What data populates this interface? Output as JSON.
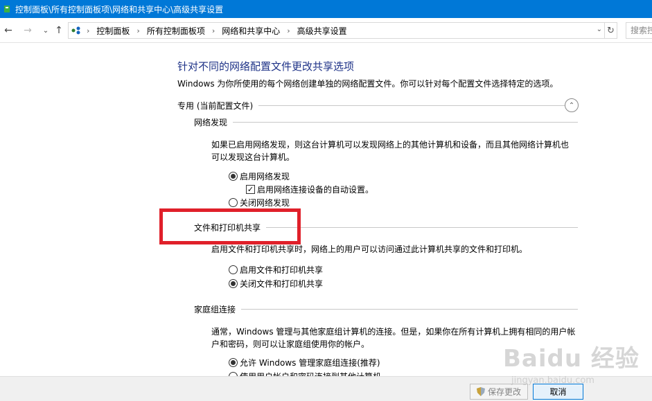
{
  "window": {
    "title": "控制面板\\所有控制面板项\\网络和共享中心\\高级共享设置"
  },
  "nav": {
    "back_icon": "arrow-left-icon",
    "forward_icon": "arrow-right-icon",
    "recent_icon": "chevron-down-icon",
    "up_icon": "arrow-up-icon"
  },
  "address": {
    "crumbs": [
      "控制面板",
      "所有控制面板项",
      "网络和共享中心",
      "高级共享设置"
    ],
    "search_placeholder": "搜索控"
  },
  "page": {
    "title": "针对不同的网络配置文件更改共享选项",
    "description": "Windows 为你所使用的每个网络创建单独的网络配置文件。你可以针对每个配置文件选择特定的选项。"
  },
  "profile": {
    "label": "专用 (当前配置文件)"
  },
  "network_discovery": {
    "heading": "网络发现",
    "text_line1": "如果已启用网络发现，则这台计算机可以发现网络上的其他计算机和设备，而且其他网络计算机也",
    "text_line2": "可以发现这台计算机。",
    "option_on": "启用网络发现",
    "option_auto": "启用网络连接设备的自动设置。",
    "option_off": "关闭网络发现",
    "selected": "on",
    "auto_checked": true
  },
  "file_printer_sharing": {
    "heading": "文件和打印机共享",
    "text": "启用文件和打印机共享时，网络上的用户可以访问通过此计算机共享的文件和打印机。",
    "option_on": "启用文件和打印机共享",
    "option_off": "关闭文件和打印机共享",
    "selected": "off"
  },
  "homegroup": {
    "heading": "家庭组连接",
    "text_line1": "通常，Windows 管理与其他家庭组计算机的连接。但是，如果你在所有计算机上拥有相同的用户帐",
    "text_line2": "户和密码，则可以让家庭组使用你的帐户。",
    "option_allow": "允许 Windows 管理家庭组连接(推荐)",
    "option_user": "使用用户帐户和密码连接到其他计算机",
    "selected": "allow"
  },
  "footer": {
    "save_label": "保存更改",
    "cancel_label": "取消"
  },
  "watermark": {
    "brand": "Baidu 经验",
    "url": "jingyan.baidu.com"
  },
  "colors": {
    "titlebar": "#0078d7",
    "heading_blue": "#1e3287",
    "highlight_red": "#e0202a"
  }
}
